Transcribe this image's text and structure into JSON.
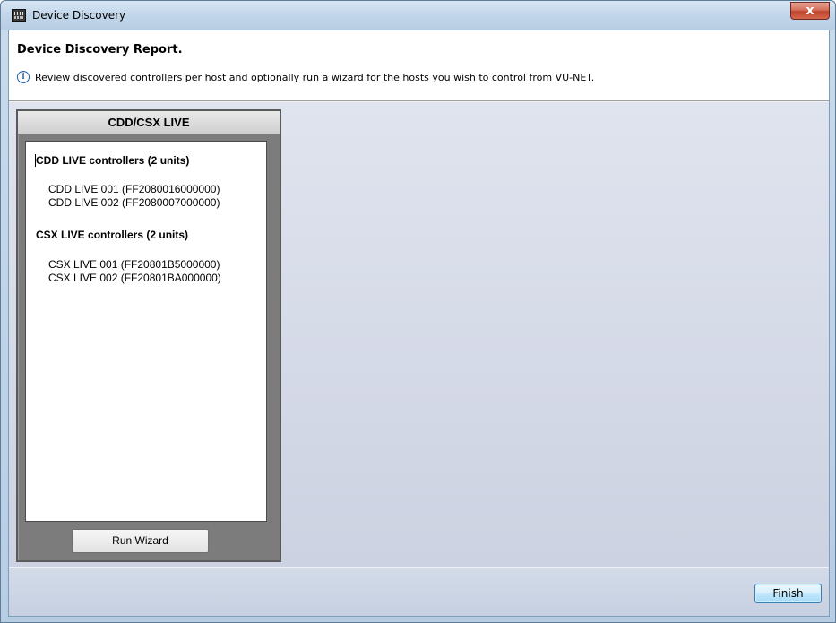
{
  "window": {
    "title": "Device Discovery",
    "close_label": "x"
  },
  "header": {
    "title": "Device Discovery Report.",
    "info_glyph": "i",
    "description": "Review discovered controllers per host and optionally run a wizard for the hosts you wish to control from VU-NET."
  },
  "host_panel": {
    "title": "CDD/CSX LIVE",
    "groups": [
      {
        "title": "CDD LIVE controllers (2 units)",
        "devices": [
          "CDD LIVE 001 (FF2080016000000)",
          "CDD LIVE 002 (FF2080007000000)"
        ]
      },
      {
        "title": "CSX LIVE controllers (2 units)",
        "devices": [
          "CSX LIVE 001 (FF20801B5000000)",
          "CSX LIVE 002 (FF20801BA000000)"
        ]
      }
    ],
    "run_wizard_label": "Run Wizard"
  },
  "footer": {
    "finish_label": "Finish"
  },
  "icons": {
    "app": "device-discovery-app-icon",
    "info": "info-icon",
    "close": "close-icon"
  }
}
